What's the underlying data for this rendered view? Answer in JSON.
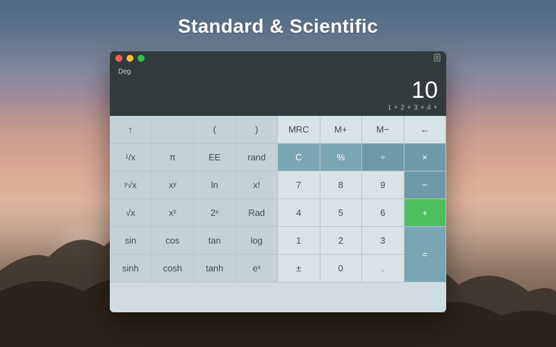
{
  "heading": "Standard & Scientific",
  "window": {
    "traffic": [
      "close",
      "minimize",
      "zoom"
    ],
    "history_icon": "history-icon"
  },
  "display": {
    "mode": "Deg",
    "result": "10",
    "expression": "1 + 2 + 3 + 4 +"
  },
  "keys": {
    "r0": [
      "↑",
      "",
      "(",
      ")",
      "MRC",
      "M+",
      "M−",
      "←"
    ],
    "r1": [
      "¹/x",
      "π",
      "EE",
      "rand",
      "C",
      "%",
      "÷",
      "×"
    ],
    "r2": [
      "ʸ√x",
      "xʸ",
      "ln",
      "x!",
      "7",
      "8",
      "9",
      "−"
    ],
    "r3": [
      "√x",
      "x²",
      "2ˣ",
      "Rad",
      "4",
      "5",
      "6",
      "+"
    ],
    "r4": [
      "sin",
      "cos",
      "tan",
      "log",
      "1",
      "2",
      "3",
      "="
    ],
    "r5": [
      "sinh",
      "cosh",
      "tanh",
      "eˣ",
      "±",
      "0",
      "."
    ]
  },
  "colors": {
    "sci_bg": "#c3d2d7",
    "num_bg": "#d6e3e7",
    "teal": "#78a6b3",
    "dark_teal": "#6d9aa8",
    "green": "#4fbf5e",
    "display_bg": "#323a3c"
  }
}
